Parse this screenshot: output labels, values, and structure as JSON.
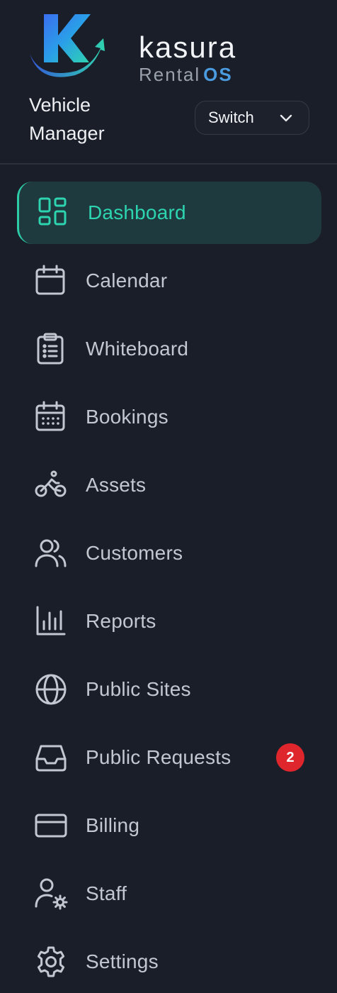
{
  "brand": {
    "name": "kasura",
    "sub_text": "Rental",
    "sub_accent": "OS",
    "logo_letter": "K"
  },
  "header": {
    "role_title": "Vehicle Manager",
    "switch_label": "Switch"
  },
  "colors": {
    "background": "#1a1e28",
    "active_accent": "#2dd4b0",
    "active_background": "#1f3a3e",
    "badge": "#e0262d"
  },
  "nav": {
    "items": [
      {
        "label": "Dashboard",
        "icon": "dashboard-icon",
        "active": true
      },
      {
        "label": "Calendar",
        "icon": "calendar-icon"
      },
      {
        "label": "Whiteboard",
        "icon": "clipboard-icon"
      },
      {
        "label": "Bookings",
        "icon": "calendar-grid-icon"
      },
      {
        "label": "Assets",
        "icon": "bicycle-icon"
      },
      {
        "label": "Customers",
        "icon": "users-icon"
      },
      {
        "label": "Reports",
        "icon": "bar-chart-icon"
      },
      {
        "label": "Public Sites",
        "icon": "globe-icon"
      },
      {
        "label": "Public Requests",
        "icon": "inbox-icon",
        "badge": "2"
      },
      {
        "label": "Billing",
        "icon": "credit-card-icon"
      },
      {
        "label": "Staff",
        "icon": "user-settings-icon"
      },
      {
        "label": "Settings",
        "icon": "gear-icon"
      }
    ]
  }
}
